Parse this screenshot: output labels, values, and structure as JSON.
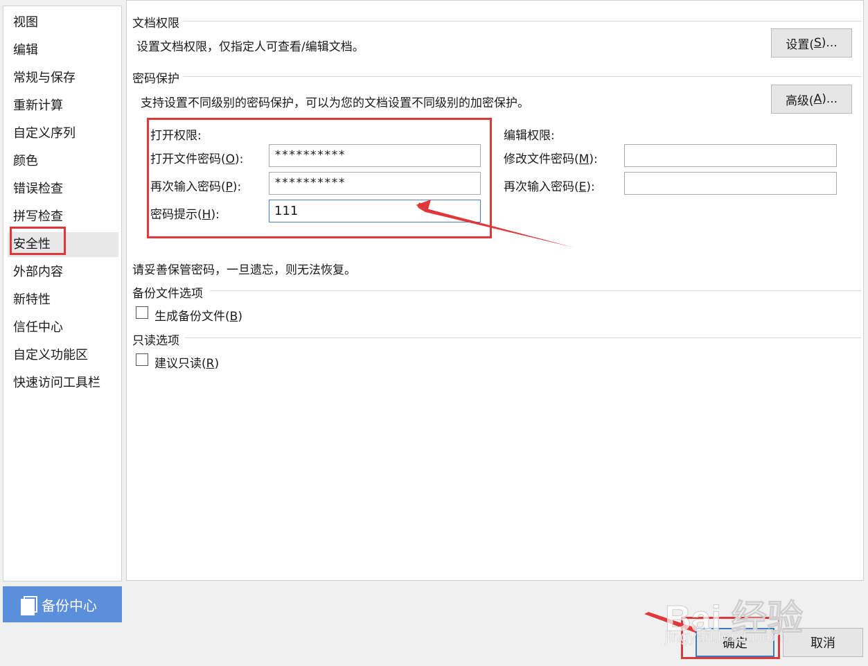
{
  "sidebar": {
    "items": [
      {
        "label": "视图"
      },
      {
        "label": "编辑"
      },
      {
        "label": "常规与保存"
      },
      {
        "label": "重新计算"
      },
      {
        "label": "自定义序列"
      },
      {
        "label": "颜色"
      },
      {
        "label": "错误检查"
      },
      {
        "label": "拼写检查"
      },
      {
        "label": "安全性"
      },
      {
        "label": "外部内容"
      },
      {
        "label": "新特性"
      },
      {
        "label": "信任中心"
      },
      {
        "label": "自定义功能区"
      },
      {
        "label": "快速访问工具栏"
      }
    ],
    "selected": "安全性",
    "backup_center_label": "备份中心"
  },
  "doc_permission": {
    "title": "文档权限",
    "description": "设置文档权限，仅指定人可查看/编辑文档。",
    "button_text": "设置(",
    "button_key": "S",
    "button_tail": ")..."
  },
  "password_protection": {
    "title": "密码保护",
    "description": "支持设置不同级别的密码保护，可以为您的文档设置不同级别的加密保护。",
    "advanced_text": "高级(",
    "advanced_key": "A",
    "advanced_tail": ")...",
    "open": {
      "heading": "打开权限:",
      "password_label": "打开文件密码(",
      "password_key": "O",
      "password_tail": "):",
      "password_value": "**********",
      "confirm_label": "再次输入密码(",
      "confirm_key": "P",
      "confirm_tail": "):",
      "confirm_value": "**********",
      "hint_label": "密码提示(",
      "hint_key": "H",
      "hint_tail": "):",
      "hint_value": "111"
    },
    "edit": {
      "heading": "编辑权限:",
      "password_label": "修改文件密码(",
      "password_key": "M",
      "password_tail": "):",
      "password_value": "",
      "confirm_label": "再次输入密码(",
      "confirm_key": "E",
      "confirm_tail": "):",
      "confirm_value": ""
    },
    "warning": "请妥善保管密码，一旦遗忘，则无法恢复。"
  },
  "backup_options": {
    "title": "备份文件选项",
    "checkbox_text": "生成备份文件(",
    "checkbox_key": "B",
    "checkbox_tail": ")",
    "checked": false
  },
  "readonly_options": {
    "title": "只读选项",
    "checkbox_text": "建议只读(",
    "checkbox_key": "R",
    "checkbox_tail": ")",
    "checked": false
  },
  "footer": {
    "ok_label": "确定",
    "cancel_label": "取消"
  },
  "watermark": {
    "main": "Bai 经验",
    "sub": "jingyan.baidu.com"
  },
  "colors": {
    "annotation_red": "#e0383a",
    "sidebar_accent": "#5b8fdc",
    "focus_blue": "#4a7fc1"
  }
}
